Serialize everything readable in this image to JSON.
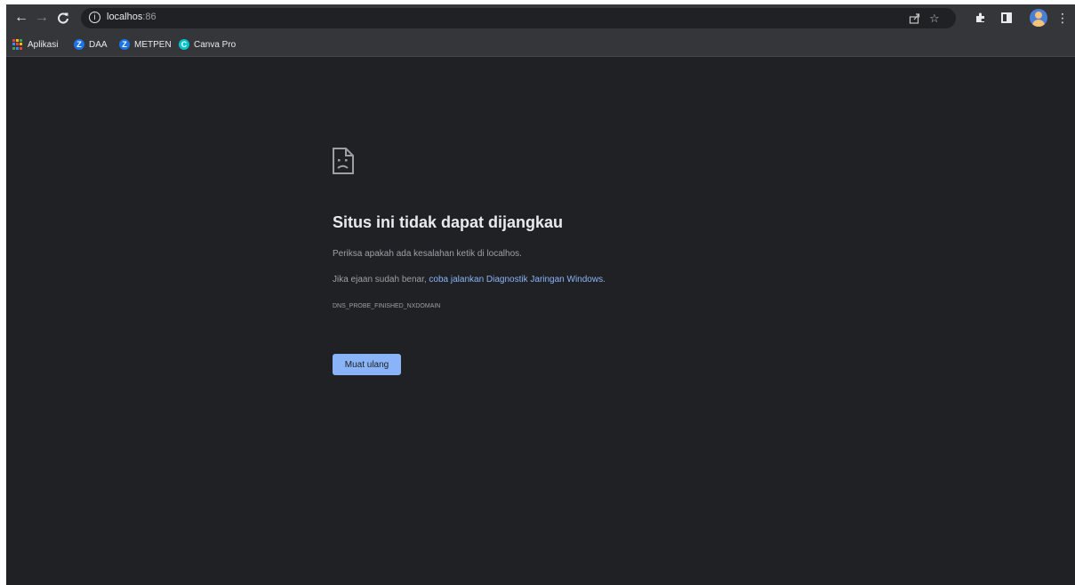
{
  "browser": {
    "address": {
      "host": "localhos",
      "port": ":86"
    },
    "bookmarks": [
      {
        "label": "Aplikasi",
        "icon": "apps-grid-icon"
      },
      {
        "label": "DAA",
        "icon": "z-icon",
        "color": "#1a73e8"
      },
      {
        "label": "METPEN",
        "icon": "z-icon",
        "color": "#1a73e8"
      },
      {
        "label": "Canva Pro",
        "icon": "canva-icon",
        "color": "#00c4cc"
      }
    ]
  },
  "error_page": {
    "title": "Situs ini tidak dapat dijangkau",
    "check_text": "Periksa apakah ada kesalahan ketik di localhos.",
    "spelling_prefix": "Jika ejaan sudah benar, ",
    "diagnostics_link": "coba jalankan Diagnostik Jaringan Windows",
    "spelling_suffix": ".",
    "error_code": "DNS_PROBE_FINISHED_NXDOMAIN",
    "reload_label": "Muat ulang"
  },
  "colors": {
    "page_bg": "#202124",
    "toolbar_bg": "#35363a",
    "link": "#8ab4f8",
    "button": "#8ab4f8"
  }
}
